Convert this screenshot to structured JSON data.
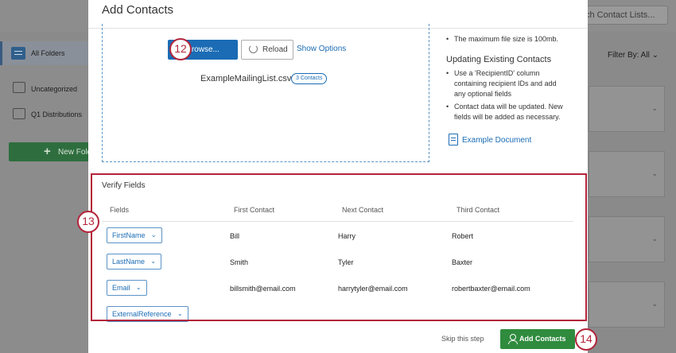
{
  "background": {
    "search_placeholder": "ch Contact Lists...",
    "sidebar": {
      "all_folders": "All Folders",
      "uncategorized": "Uncategorized",
      "q1_distributions": "Q1 Distributions",
      "new_folder": "New Fold"
    },
    "filter_by": "Filter By: All"
  },
  "modal": {
    "title": "Add Contacts",
    "upload": {
      "browse_label": "Browse...",
      "reload_label": "Reload",
      "show_options_label": "Show Options",
      "filename": "ExampleMailingList.csv",
      "contacts_badge": "3 Contacts"
    },
    "info": {
      "bullet_max_size": "The maximum file size is 100mb.",
      "updating_heading": "Updating Existing Contacts",
      "bullet_recipient_id": "Use a 'RecipientID' column containing recipient IDs and add any optional fields",
      "bullet_contact_updated": "Contact data will be updated. New fields will be added as necessary.",
      "example_document": "Example Document"
    },
    "verify": {
      "title": "Verify Fields",
      "columns": [
        "Fields",
        "First Contact",
        "Next Contact",
        "Third Contact"
      ],
      "rows": [
        {
          "field": "FirstName",
          "first": "Bill",
          "next": "Harry",
          "third": "Robert"
        },
        {
          "field": "LastName",
          "first": "Smith",
          "next": "Tyler",
          "third": "Baxter"
        },
        {
          "field": "Email",
          "first": "billsmith@email.com",
          "next": "harrytyler@email.com",
          "third": "robertbaxter@email.com"
        },
        {
          "field": "ExternalReference",
          "first": "",
          "next": "",
          "third": ""
        }
      ]
    },
    "footer": {
      "skip_label": "Skip this step",
      "add_contacts_label": "Add Contacts"
    }
  },
  "annotations": {
    "step_12": "12",
    "step_13": "13",
    "step_14": "14"
  },
  "colors": {
    "accent_blue": "#1b6cb5",
    "action_green": "#2f8b3e",
    "annotation_red": "#b3243a"
  }
}
